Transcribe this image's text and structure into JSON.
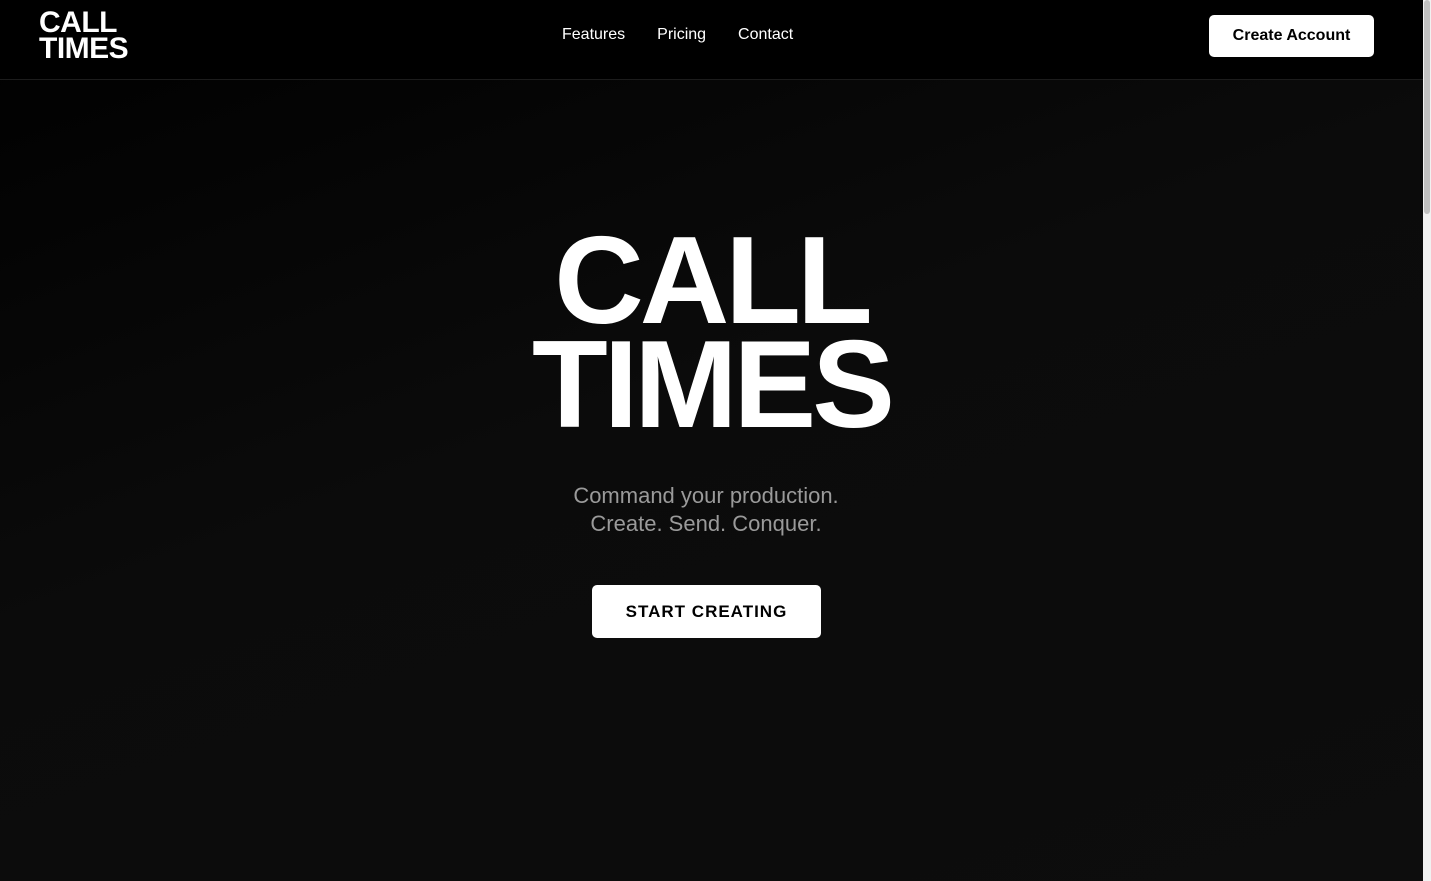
{
  "nav": {
    "logo_line1": "CALL",
    "logo_line2": "TIMES",
    "links": [
      {
        "label": "Features"
      },
      {
        "label": "Pricing"
      },
      {
        "label": "Contact"
      }
    ],
    "cta_label": "Create Account"
  },
  "hero": {
    "title_line1": "CALL",
    "title_line2": "TIMES",
    "subtitle_line1": "Command your production.",
    "subtitle_line2": "Create. Send. Conquer.",
    "button_label": "START CREATING"
  },
  "colors": {
    "background": "#000000",
    "text": "#ffffff",
    "subtitle": "#9a9a9a",
    "button_bg": "#ffffff",
    "button_text": "#000000"
  }
}
